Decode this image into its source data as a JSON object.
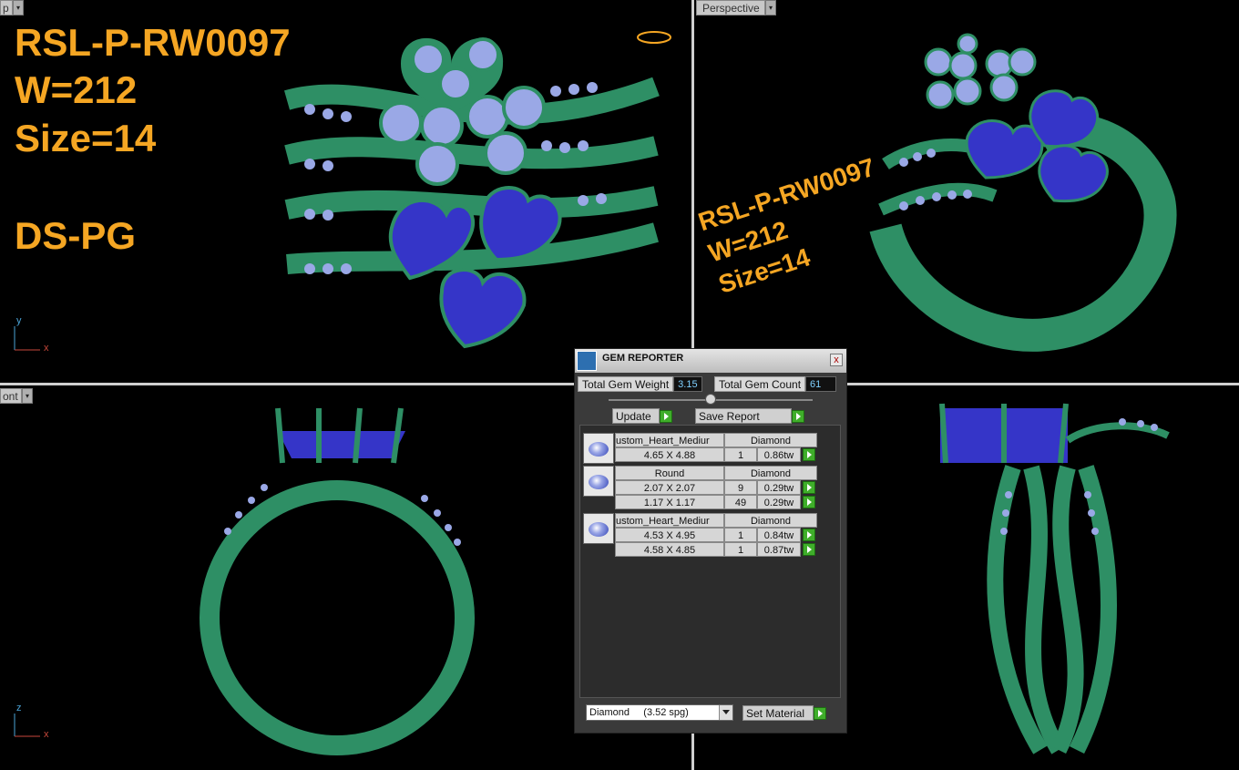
{
  "viewports": {
    "top_left": {
      "label": "p"
    },
    "top_right": {
      "label": "Perspective"
    },
    "bottom_left": {
      "label": "ont"
    }
  },
  "design_info": {
    "code": "RSL-P-RW0097",
    "weight": "W=212",
    "size": "Size=14",
    "material": "DS-PG"
  },
  "perspective_text": {
    "code": "RSL-P-RW0097",
    "weight": "W=212",
    "size": "Size=14"
  },
  "axes": {
    "y": "y",
    "x": "x",
    "z": "z"
  },
  "gem_reporter": {
    "title": "GEM REPORTER",
    "close": "x",
    "total_weight_label": "Total Gem Weight",
    "total_weight_value": "3.15",
    "total_count_label": "Total Gem Count",
    "total_count_value": "61",
    "update_label": "Update",
    "save_report_label": "Save Report",
    "groups": [
      {
        "shape": "ustom_Heart_Mediur",
        "material": "Diamond",
        "rows": [
          {
            "size": "4.65 X 4.88",
            "count": "1",
            "weight": "0.86tw"
          }
        ]
      },
      {
        "shape": "Round",
        "material": "Diamond",
        "rows": [
          {
            "size": "2.07 X 2.07",
            "count": "9",
            "weight": "0.29tw"
          },
          {
            "size": "1.17 X 1.17",
            "count": "49",
            "weight": "0.29tw"
          }
        ]
      },
      {
        "shape": "ustom_Heart_Mediur",
        "material": "Diamond",
        "rows": [
          {
            "size": "4.53 X 4.95",
            "count": "1",
            "weight": "0.84tw"
          },
          {
            "size": "4.58 X 4.85",
            "count": "1",
            "weight": "0.87tw"
          }
        ]
      }
    ],
    "material_select": "Diamond     (3.52 spg)",
    "set_material_label": "Set Material"
  },
  "colors": {
    "metal": "#2e8f65",
    "sapphire": "#3535c8",
    "diamond": "#9aa8e6",
    "text_accent": "#f5a623"
  }
}
